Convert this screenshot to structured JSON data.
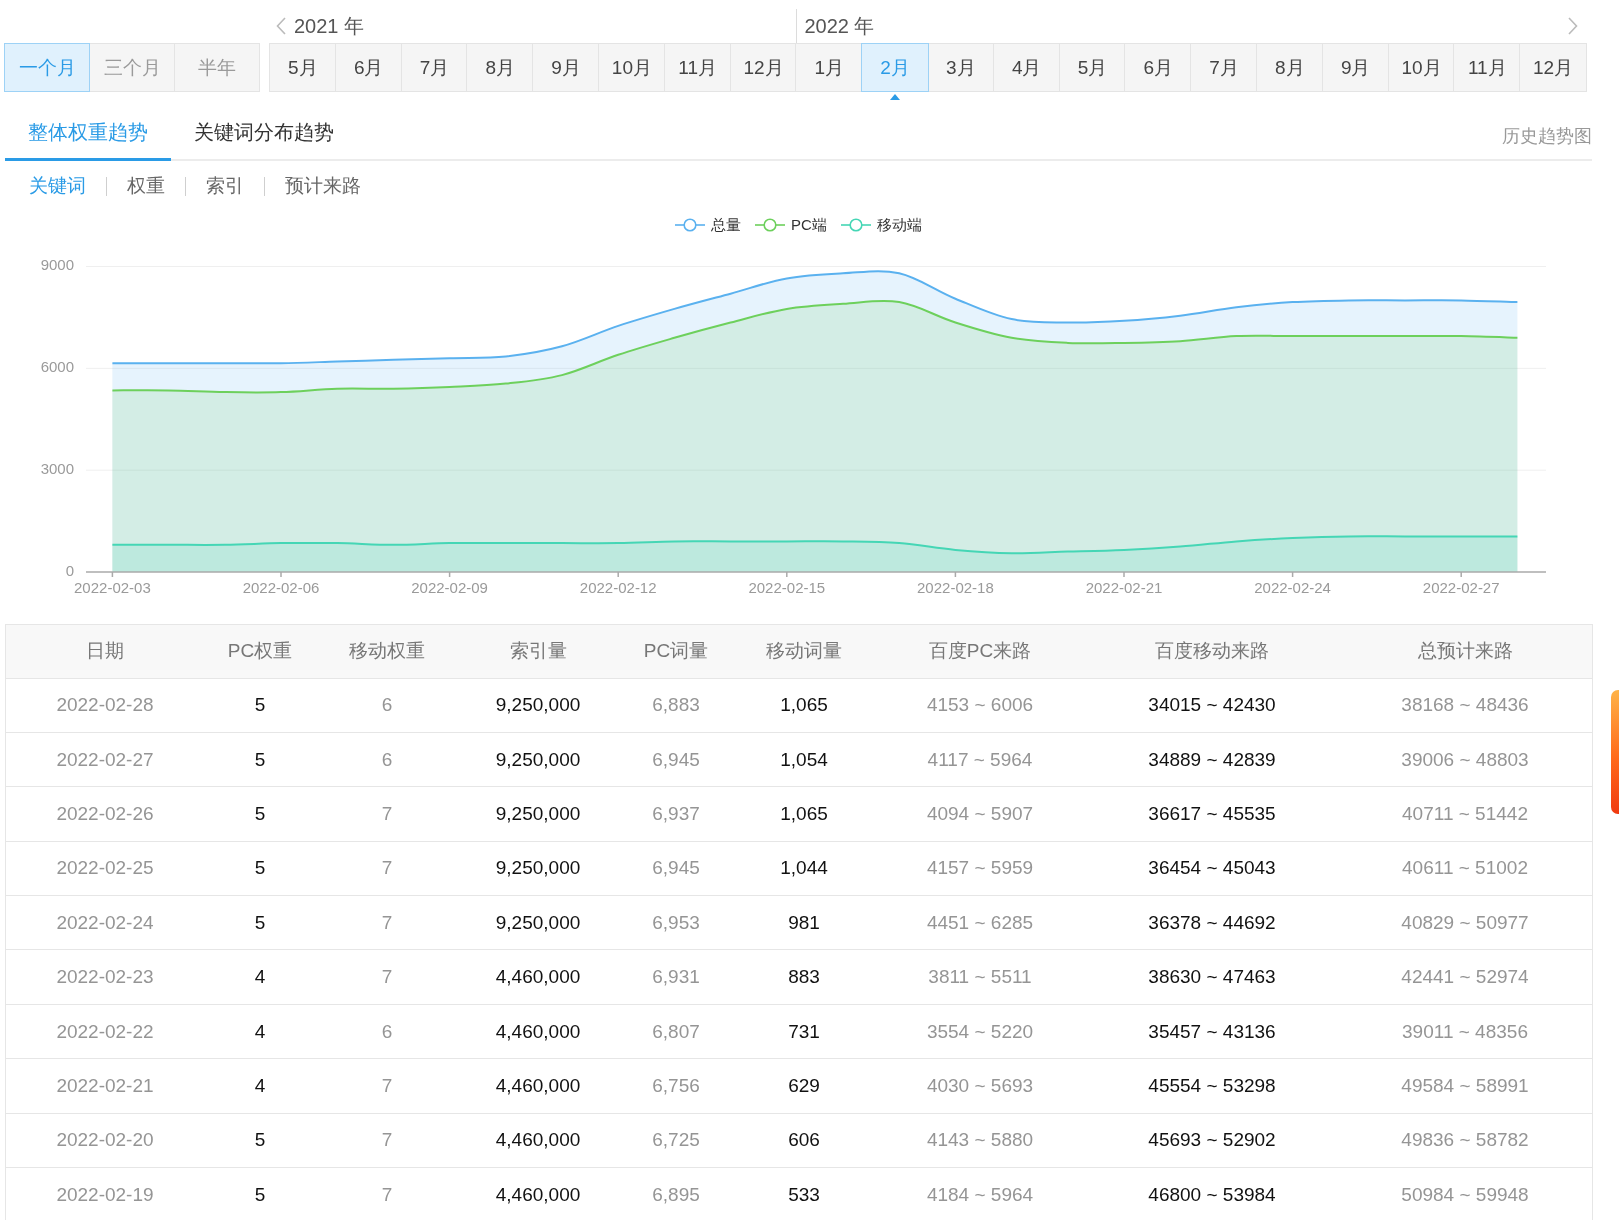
{
  "period_buttons": [
    {
      "label": "一个月",
      "selected": true
    },
    {
      "label": "三个月",
      "selected": false
    },
    {
      "label": "半年",
      "selected": false
    }
  ],
  "month_picker": {
    "years": [
      {
        "label": "2021 年",
        "months": [
          {
            "label": "5月",
            "selected": false
          },
          {
            "label": "6月",
            "selected": false
          },
          {
            "label": "7月",
            "selected": false
          },
          {
            "label": "8月",
            "selected": false
          },
          {
            "label": "9月",
            "selected": false
          },
          {
            "label": "10月",
            "selected": false
          },
          {
            "label": "11月",
            "selected": false
          },
          {
            "label": "12月",
            "selected": false
          }
        ]
      },
      {
        "label": "2022 年",
        "months": [
          {
            "label": "1月",
            "selected": false
          },
          {
            "label": "2月",
            "selected": true
          },
          {
            "label": "3月",
            "selected": false
          },
          {
            "label": "4月",
            "selected": false
          },
          {
            "label": "5月",
            "selected": false
          },
          {
            "label": "6月",
            "selected": false
          },
          {
            "label": "7月",
            "selected": false
          },
          {
            "label": "8月",
            "selected": false
          },
          {
            "label": "9月",
            "selected": false
          },
          {
            "label": "10月",
            "selected": false
          },
          {
            "label": "11月",
            "selected": false
          },
          {
            "label": "12月",
            "selected": false
          }
        ]
      }
    ]
  },
  "tabs": [
    {
      "label": "整体权重趋势",
      "selected": true
    },
    {
      "label": "关键词分布趋势",
      "selected": false
    }
  ],
  "history_link": "历史趋势图",
  "sub_tabs": [
    {
      "label": "关键词",
      "selected": true
    },
    {
      "label": "权重",
      "selected": false
    },
    {
      "label": "索引",
      "selected": false
    },
    {
      "label": "预计来路",
      "selected": false
    }
  ],
  "chart": {
    "chart_data": {
      "type": "area",
      "categories": [
        "2022-02-03",
        null,
        null,
        "2022-02-06",
        null,
        null,
        "2022-02-09",
        null,
        null,
        "2022-02-12",
        null,
        null,
        "2022-02-15",
        null,
        null,
        "2022-02-18",
        null,
        null,
        "2022-02-21",
        null,
        null,
        "2022-02-24",
        null,
        null,
        "2022-02-27",
        null
      ],
      "series": [
        {
          "name": "总量",
          "color": "#5ab1ef",
          "values": [
            6150,
            6150,
            6150,
            6150,
            6200,
            6250,
            6300,
            6350,
            6650,
            7250,
            7750,
            8200,
            8650,
            8800,
            8800,
            8050,
            7450,
            7350,
            7400,
            7550,
            7800,
            7950,
            8000,
            8000,
            8000,
            7950
          ]
        },
        {
          "name": "PC端",
          "color": "#6dd05c",
          "values": [
            5350,
            5350,
            5300,
            5300,
            5400,
            5400,
            5450,
            5550,
            5800,
            6400,
            6900,
            7350,
            7750,
            7900,
            7950,
            7350,
            6900,
            6750,
            6750,
            6800,
            6950,
            6950,
            6950,
            6950,
            6950,
            6900
          ]
        },
        {
          "name": "移动端",
          "color": "#45d6b5",
          "values": [
            800,
            800,
            800,
            850,
            850,
            800,
            850,
            850,
            850,
            850,
            900,
            900,
            900,
            900,
            850,
            650,
            550,
            600,
            650,
            750,
            900,
            1000,
            1050,
            1050,
            1050,
            1050
          ]
        }
      ],
      "ylim": [
        0,
        9000
      ],
      "yticks": [
        0,
        3000,
        6000,
        9000
      ],
      "stacked": false
    }
  },
  "table": {
    "columns": [
      "日期",
      "PC权重",
      "移动权重",
      "索引量",
      "PC词量",
      "移动词量",
      "百度PC来路",
      "百度移动来路",
      "总预计来路"
    ],
    "rows": [
      [
        "2022-02-28",
        "5",
        "6",
        "9,250,000",
        "6,883",
        "1,065",
        "4153 ~ 6006",
        "34015 ~ 42430",
        "38168 ~ 48436"
      ],
      [
        "2022-02-27",
        "5",
        "6",
        "9,250,000",
        "6,945",
        "1,054",
        "4117 ~ 5964",
        "34889 ~ 42839",
        "39006 ~ 48803"
      ],
      [
        "2022-02-26",
        "5",
        "7",
        "9,250,000",
        "6,937",
        "1,065",
        "4094 ~ 5907",
        "36617 ~ 45535",
        "40711 ~ 51442"
      ],
      [
        "2022-02-25",
        "5",
        "7",
        "9,250,000",
        "6,945",
        "1,044",
        "4157 ~ 5959",
        "36454 ~ 45043",
        "40611 ~ 51002"
      ],
      [
        "2022-02-24",
        "5",
        "7",
        "9,250,000",
        "6,953",
        "981",
        "4451 ~ 6285",
        "36378 ~ 44692",
        "40829 ~ 50977"
      ],
      [
        "2022-02-23",
        "4",
        "7",
        "4,460,000",
        "6,931",
        "883",
        "3811 ~ 5511",
        "38630 ~ 47463",
        "42441 ~ 52974"
      ],
      [
        "2022-02-22",
        "4",
        "6",
        "4,460,000",
        "6,807",
        "731",
        "3554 ~ 5220",
        "35457 ~ 43136",
        "39011 ~ 48356"
      ],
      [
        "2022-02-21",
        "4",
        "7",
        "4,460,000",
        "6,756",
        "629",
        "4030 ~ 5693",
        "45554 ~ 53298",
        "49584 ~ 58991"
      ],
      [
        "2022-02-20",
        "5",
        "7",
        "4,460,000",
        "6,725",
        "606",
        "4143 ~ 5880",
        "45693 ~ 52902",
        "49836 ~ 58782"
      ],
      [
        "2022-02-19",
        "5",
        "7",
        "4,460,000",
        "6,895",
        "533",
        "4184 ~ 5964",
        "46800 ~ 53984",
        "50984 ~ 59948"
      ]
    ]
  }
}
